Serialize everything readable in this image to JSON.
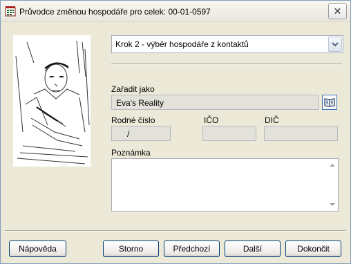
{
  "window": {
    "title": "Průvodce změnou hospodáře pro celek: 00-01-0597",
    "close_label": "✕"
  },
  "step_select": {
    "value": "Krok 2 - výběr hospodáře z kontaktů"
  },
  "form": {
    "zaradit_label": "Zařadit jako",
    "zaradit_value": "Eva's Reality",
    "rodne_label": "Rodné číslo",
    "rodne_value": "/",
    "ico_label": "IČO",
    "ico_value": "",
    "dic_label": "DIČ",
    "dic_value": "",
    "poznamka_label": "Poznámka",
    "poznamka_value": ""
  },
  "buttons": {
    "help": "Nápověda",
    "cancel": "Storno",
    "prev": "Předchozí",
    "next": "Další",
    "finish": "Dokončit"
  },
  "icons": {
    "app": "grid-app-icon",
    "sketch": "sketch-illustration",
    "book": "address-book-icon",
    "dropdown": "chevron-down-icon"
  }
}
